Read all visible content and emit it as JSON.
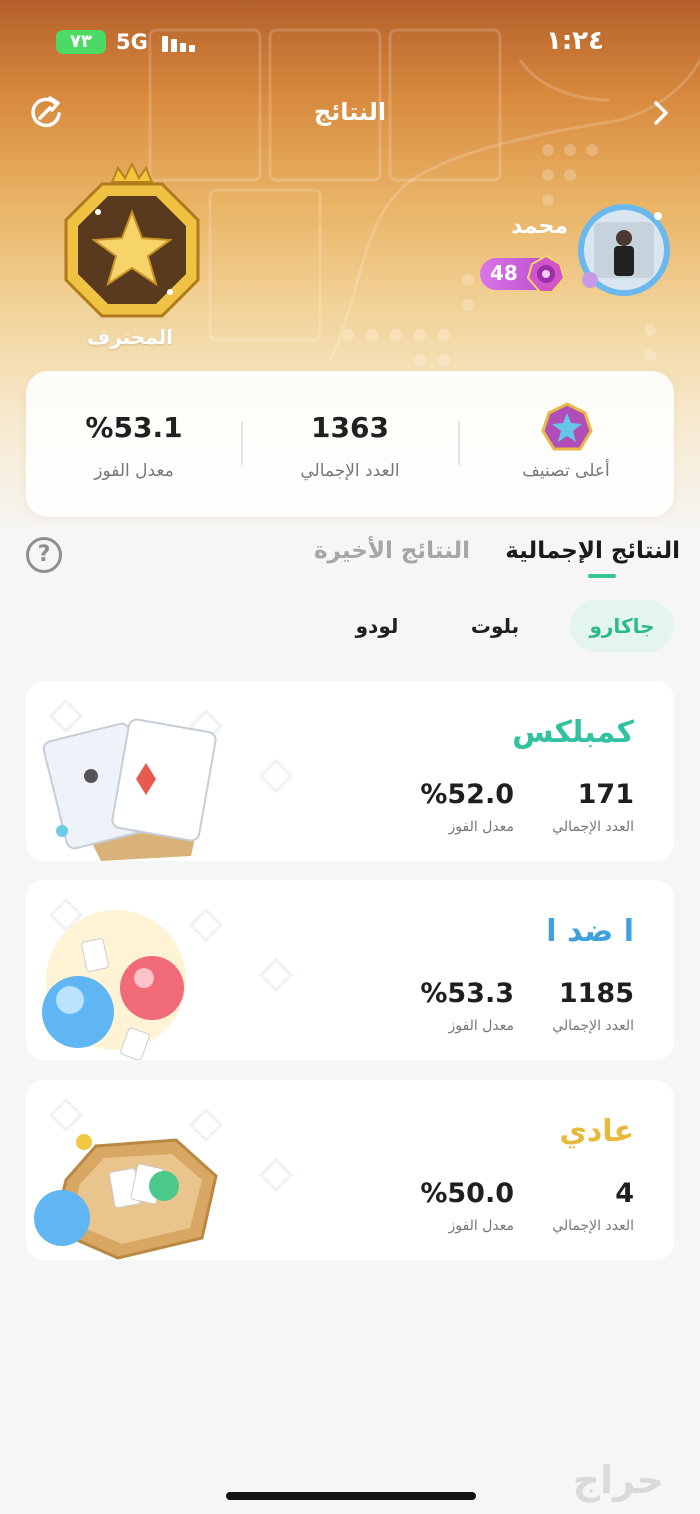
{
  "status_bar": {
    "battery": "٧٣",
    "network": "5G",
    "time": "١:٢٤"
  },
  "header": {
    "title": "النتائج"
  },
  "rank": {
    "name": "المحترف"
  },
  "user": {
    "name": "محمد",
    "level": "48"
  },
  "stats": {
    "top_rank_label": "أعلى تصنيف",
    "total_value": "1363",
    "total_label": "العدد الإجمالي",
    "winrate_value": "%53.1",
    "winrate_label": "معدل الفوز"
  },
  "tabs": {
    "overall": "النتائج الإجمالية",
    "recent": "النتائج الأخيرة"
  },
  "games": {
    "jackaroo": "جاكارو",
    "balot": "بلوت",
    "ludo": "لودو"
  },
  "modes": [
    {
      "title": "كمبلكس",
      "color": "#33c2a0",
      "total_value": "171",
      "total_label": "العدد الإجمالي",
      "winrate_value": "%52.0",
      "winrate_label": "معدل الفوز"
    },
    {
      "title": "ا ضد ا",
      "color": "#3ea0dd",
      "total_value": "1185",
      "total_label": "العدد الإجمالي",
      "winrate_value": "%53.3",
      "winrate_label": "معدل الفوز"
    },
    {
      "title": "عادي",
      "color": "#e6b93b",
      "total_value": "4",
      "total_label": "العدد الإجمالي",
      "winrate_value": "%50.0",
      "winrate_label": "معدل الفوز"
    }
  ],
  "watermark": "حراج"
}
